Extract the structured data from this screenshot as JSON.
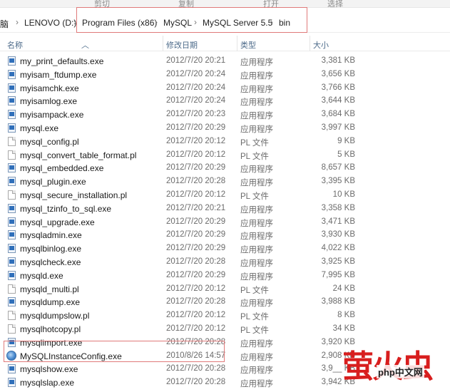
{
  "ribbon": {
    "items": [
      "剪切",
      "复制",
      "打开",
      "选择"
    ]
  },
  "address": {
    "root": "脑",
    "crumbs": [
      "LENOVO (D:)",
      "Program Files (x86)",
      "MySQL",
      "MySQL Server 5.5",
      "bin"
    ],
    "separator": "›"
  },
  "columns": {
    "name": "名称",
    "date": "修改日期",
    "type": "类型",
    "size": "大小"
  },
  "files": [
    {
      "name": "my_print_defaults.exe",
      "date": "2012/7/20 20:21",
      "type": "应用程序",
      "size": "3,381 KB",
      "icon": "exe-icon"
    },
    {
      "name": "myisam_ftdump.exe",
      "date": "2012/7/20 20:24",
      "type": "应用程序",
      "size": "3,656 KB",
      "icon": "exe-icon"
    },
    {
      "name": "myisamchk.exe",
      "date": "2012/7/20 20:24",
      "type": "应用程序",
      "size": "3,766 KB",
      "icon": "exe-icon"
    },
    {
      "name": "myisamlog.exe",
      "date": "2012/7/20 20:24",
      "type": "应用程序",
      "size": "3,644 KB",
      "icon": "exe-icon"
    },
    {
      "name": "myisampack.exe",
      "date": "2012/7/20 20:23",
      "type": "应用程序",
      "size": "3,684 KB",
      "icon": "exe-icon"
    },
    {
      "name": "mysql.exe",
      "date": "2012/7/20 20:29",
      "type": "应用程序",
      "size": "3,997 KB",
      "icon": "exe-icon"
    },
    {
      "name": "mysql_config.pl",
      "date": "2012/7/20 20:12",
      "type": "PL 文件",
      "size": "9 KB",
      "icon": "pl-file-icon"
    },
    {
      "name": "mysql_convert_table_format.pl",
      "date": "2012/7/20 20:12",
      "type": "PL 文件",
      "size": "5 KB",
      "icon": "pl-file-icon"
    },
    {
      "name": "mysql_embedded.exe",
      "date": "2012/7/20 20:29",
      "type": "应用程序",
      "size": "8,657 KB",
      "icon": "exe-icon"
    },
    {
      "name": "mysql_plugin.exe",
      "date": "2012/7/20 20:28",
      "type": "应用程序",
      "size": "3,395 KB",
      "icon": "exe-icon"
    },
    {
      "name": "mysql_secure_installation.pl",
      "date": "2012/7/20 20:12",
      "type": "PL 文件",
      "size": "10 KB",
      "icon": "pl-file-icon"
    },
    {
      "name": "mysql_tzinfo_to_sql.exe",
      "date": "2012/7/20 20:21",
      "type": "应用程序",
      "size": "3,358 KB",
      "icon": "exe-icon"
    },
    {
      "name": "mysql_upgrade.exe",
      "date": "2012/7/20 20:29",
      "type": "应用程序",
      "size": "3,471 KB",
      "icon": "exe-icon"
    },
    {
      "name": "mysqladmin.exe",
      "date": "2012/7/20 20:29",
      "type": "应用程序",
      "size": "3,930 KB",
      "icon": "exe-icon"
    },
    {
      "name": "mysqlbinlog.exe",
      "date": "2012/7/20 20:29",
      "type": "应用程序",
      "size": "4,022 KB",
      "icon": "exe-icon"
    },
    {
      "name": "mysqlcheck.exe",
      "date": "2012/7/20 20:28",
      "type": "应用程序",
      "size": "3,925 KB",
      "icon": "exe-icon"
    },
    {
      "name": "mysqld.exe",
      "date": "2012/7/20 20:29",
      "type": "应用程序",
      "size": "7,995 KB",
      "icon": "exe-icon"
    },
    {
      "name": "mysqld_multi.pl",
      "date": "2012/7/20 20:12",
      "type": "PL 文件",
      "size": "24 KB",
      "icon": "pl-file-icon"
    },
    {
      "name": "mysqldump.exe",
      "date": "2012/7/20 20:28",
      "type": "应用程序",
      "size": "3,988 KB",
      "icon": "exe-icon"
    },
    {
      "name": "mysqldumpslow.pl",
      "date": "2012/7/20 20:12",
      "type": "PL 文件",
      "size": "8 KB",
      "icon": "pl-file-icon"
    },
    {
      "name": "mysqlhotcopy.pl",
      "date": "2012/7/20 20:12",
      "type": "PL 文件",
      "size": "34 KB",
      "icon": "pl-file-icon"
    },
    {
      "name": "mysqlimport.exe",
      "date": "2012/7/20 20:28",
      "type": "应用程序",
      "size": "3,920 KB",
      "icon": "exe-icon"
    },
    {
      "name": "MySQLInstanceConfig.exe",
      "date": "2010/8/26 14:57",
      "type": "应用程序",
      "size": "2,908 KB",
      "icon": "config-app-icon"
    },
    {
      "name": "mysqlshow.exe",
      "date": "2012/7/20 20:28",
      "type": "应用程序",
      "size": "3,9__ KB",
      "icon": "exe-icon"
    },
    {
      "name": "mysqlslap.exe",
      "date": "2012/7/20 20:28",
      "type": "应用程序",
      "size": "3,942 KB",
      "icon": "exe-icon"
    }
  ],
  "watermark": {
    "big": "萤火虫",
    "small": "php中文网"
  },
  "colors": {
    "highlight": "#e07a7a",
    "header_text": "#4d6b8a",
    "watermark": "#d81e1e"
  }
}
